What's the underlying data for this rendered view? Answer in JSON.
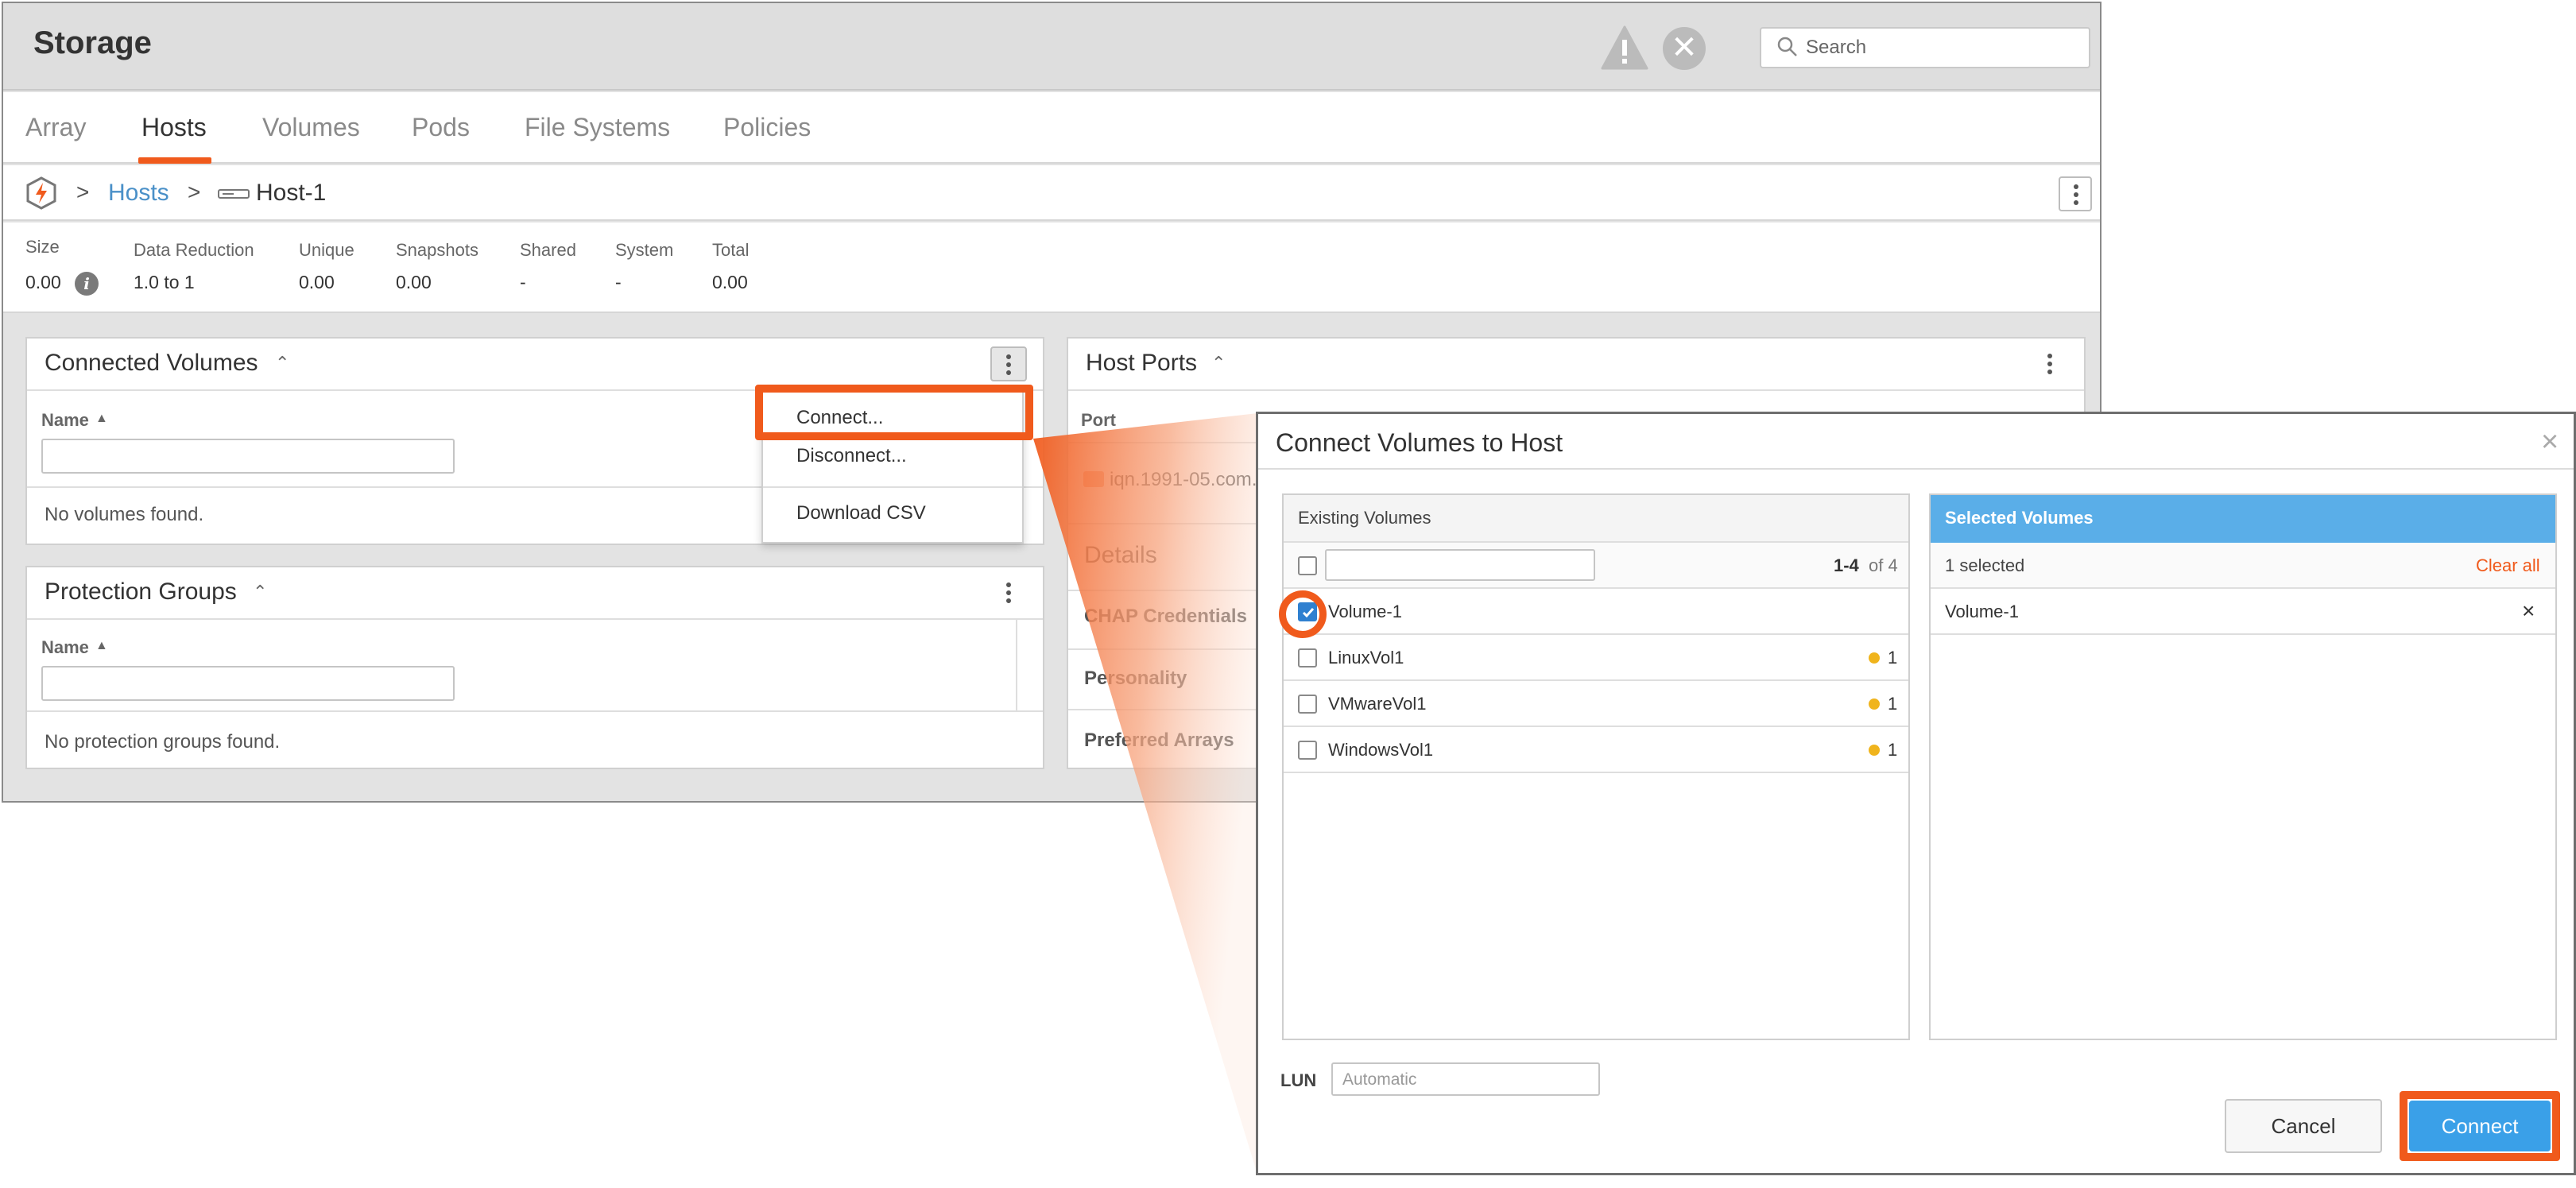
{
  "app": {
    "title": "Storage",
    "search_placeholder": "Search"
  },
  "tabs": [
    {
      "label": "Array"
    },
    {
      "label": "Hosts"
    },
    {
      "label": "Volumes"
    },
    {
      "label": "Pods"
    },
    {
      "label": "File Systems"
    },
    {
      "label": "Policies"
    }
  ],
  "breadcrumb": {
    "sep1": ">",
    "link": "Hosts",
    "sep2": ">",
    "current": "Host-1"
  },
  "stats": [
    {
      "label": "Size",
      "value": "0.00"
    },
    {
      "label": "Data Reduction",
      "value": "1.0 to 1"
    },
    {
      "label": "Unique",
      "value": "0.00"
    },
    {
      "label": "Snapshots",
      "value": "0.00"
    },
    {
      "label": "Shared",
      "value": "-"
    },
    {
      "label": "System",
      "value": "-"
    },
    {
      "label": "Total",
      "value": "0.00"
    }
  ],
  "info_glyph": "i",
  "connected_volumes": {
    "title": "Connected Volumes",
    "column": "Name",
    "empty": "No volumes found."
  },
  "menu": {
    "items": [
      "Connect...",
      "Disconnect...",
      "Download CSV"
    ]
  },
  "protection_groups": {
    "title": "Protection Groups",
    "column": "Name",
    "empty": "No protection groups found."
  },
  "host_ports": {
    "title": "Host Ports",
    "column": "Port",
    "port_value": "iqn.1991-05.com.m"
  },
  "details": {
    "title": "Details",
    "rows": [
      "CHAP Credentials",
      "Personality",
      "Preferred Arrays"
    ]
  },
  "dialog": {
    "title": "Connect Volumes to Host",
    "close_glyph": "×",
    "existing": {
      "title": "Existing Volumes",
      "count_bold": "1-4",
      "count_rest": "of 4",
      "volumes": [
        {
          "name": "Volume-1",
          "checked": true,
          "connections": ""
        },
        {
          "name": "LinuxVol1",
          "checked": false,
          "connections": "1"
        },
        {
          "name": "VMwareVol1",
          "checked": false,
          "connections": "1"
        },
        {
          "name": "WindowsVol1",
          "checked": false,
          "connections": "1"
        }
      ]
    },
    "selected": {
      "title": "Selected Volumes",
      "count": "1 selected",
      "clear": "Clear all",
      "items": [
        {
          "name": "Volume-1",
          "remove": "×"
        }
      ]
    },
    "lun_label": "LUN",
    "lun_placeholder": "Automatic",
    "cancel": "Cancel",
    "connect": "Connect"
  },
  "colors": {
    "accent": "#f05a1c",
    "link": "#4a90c8",
    "selected_header": "#5aaee8",
    "primary_button": "#3aa0e8",
    "dot": "#f0b41c"
  },
  "icons": [
    "warning-icon",
    "error-icon",
    "search-icon",
    "logo-icon",
    "host-icon",
    "kebab-icon",
    "info-icon",
    "chevron-up-icon",
    "sort-up-icon",
    "checkmark-icon",
    "close-icon"
  ]
}
